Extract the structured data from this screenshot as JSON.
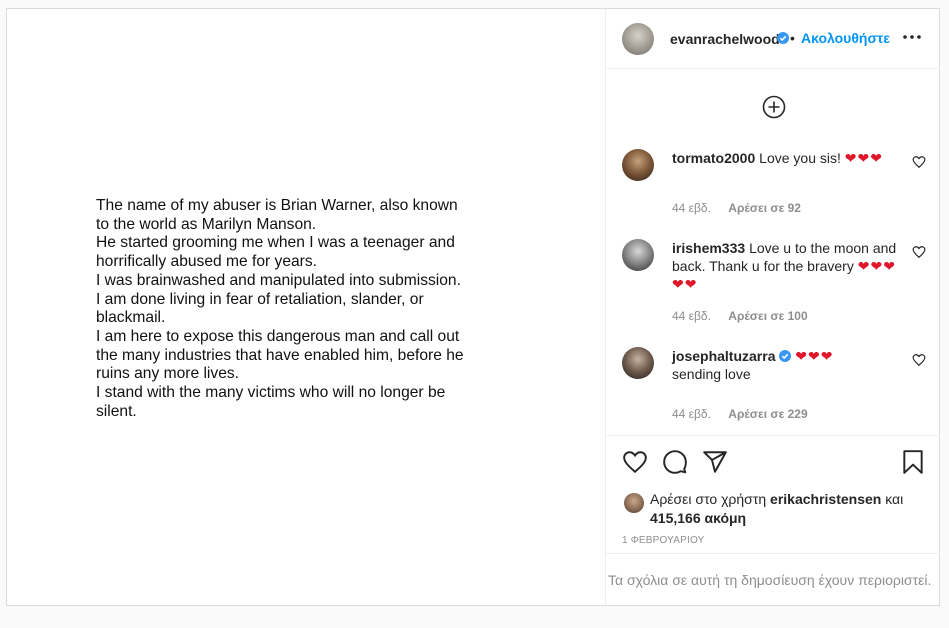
{
  "post_image": {
    "lines": [
      "The name of my abuser is Brian Warner, also known",
      "to the world as Marilyn Manson.",
      "He started grooming me when I was a teenager and",
      "horrifically abused me for years.",
      "I was brainwashed and manipulated into submission.",
      "I am done living in fear of retaliation, slander, or",
      "blackmail.",
      "I am here to expose this dangerous man and call out",
      "the many industries that have enabled him, before he",
      "ruins any more lives.",
      "I stand with the many victims who will no longer be",
      "silent."
    ]
  },
  "header": {
    "username": "evanrachelwood",
    "separator": "•",
    "follow_label": "Ακολουθήστε"
  },
  "comments": [
    {
      "user": "tormato2000",
      "text": "Love you sis!",
      "hearts": "❤❤❤",
      "time": "44 εβδ.",
      "likes": "Αρέσει σε 92"
    },
    {
      "user": "irishem333",
      "text": "Love u to the moon and back. Thank u for the bravery",
      "hearts": "❤❤❤❤❤",
      "time": "44 εβδ.",
      "likes": "Αρέσει σε 100"
    },
    {
      "user": "josephaltuzarra",
      "text": "sending love",
      "hearts": "❤❤❤",
      "time": "44 εβδ.",
      "likes": "Αρέσει σε 229"
    }
  ],
  "likes": {
    "prefix": "Αρέσει στο χρήστη",
    "user": "erikachristensen",
    "and": "και",
    "count": "415,166 ακόμη"
  },
  "date": "1 ΦΕΒΡΟΥΑΡΙΟΥ",
  "restricted_text": "Τα σχόλια σε αυτή τη δημοσίευση έχουν περιοριστεί.",
  "colors": {
    "accent": "#0095f6",
    "heart": "#e0162b",
    "muted": "#8e8e8e"
  }
}
